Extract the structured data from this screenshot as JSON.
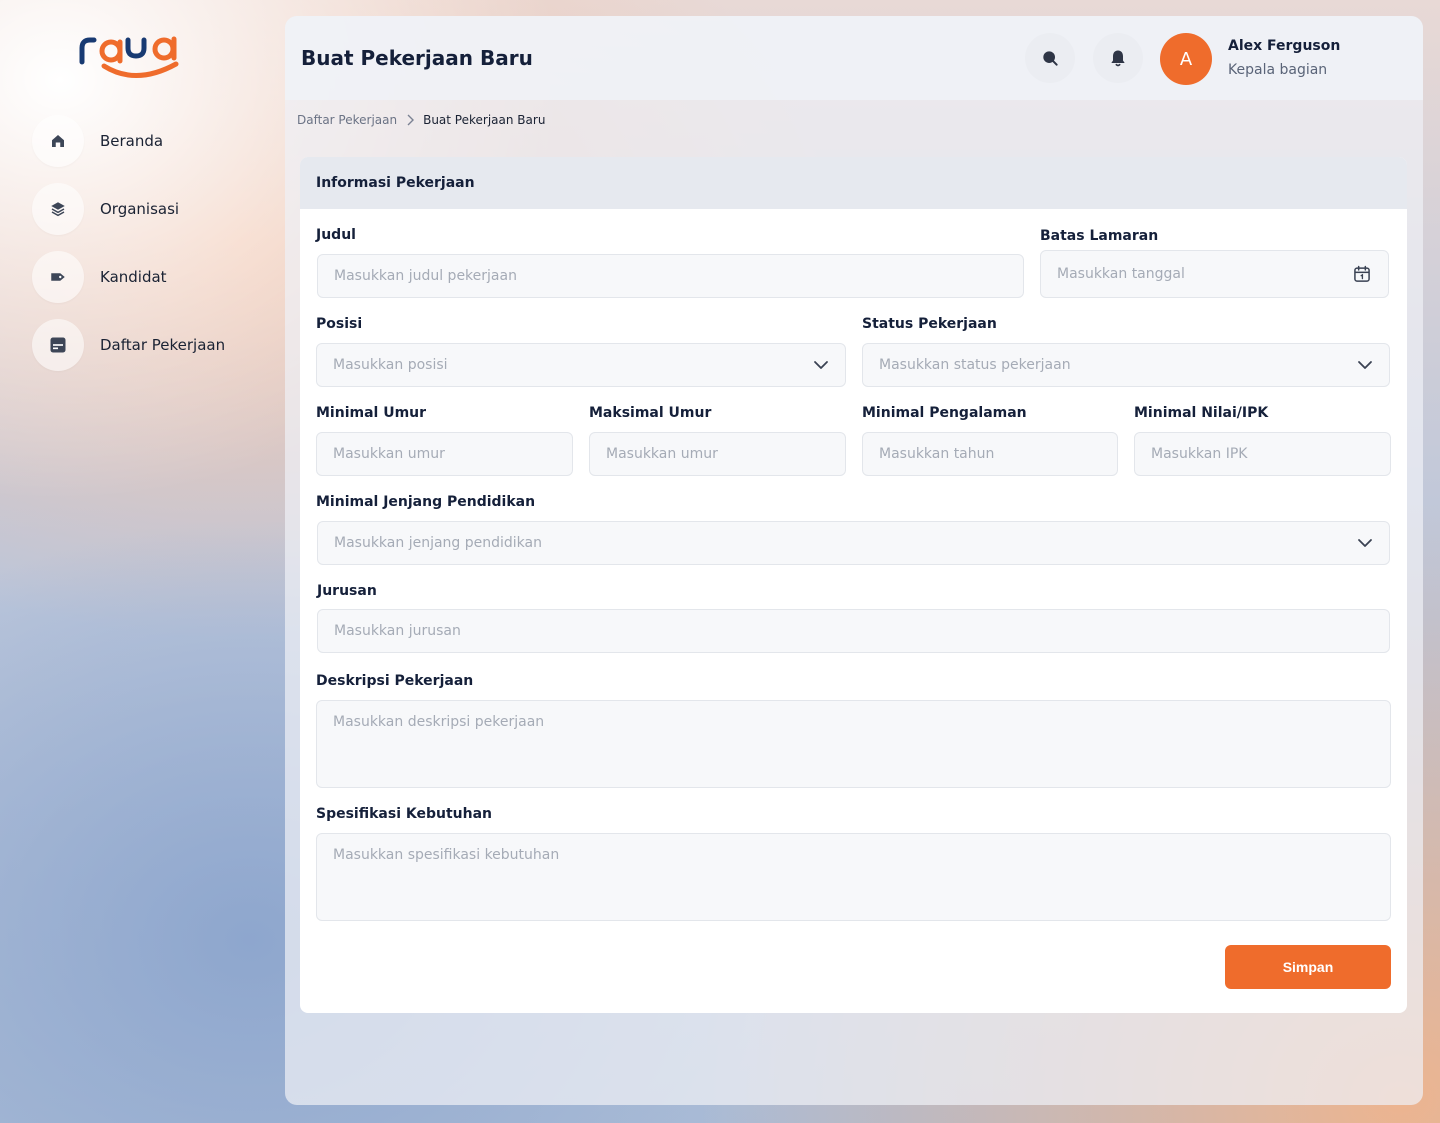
{
  "brand": {
    "logo_text": "raya",
    "accent": "#ef6c2c"
  },
  "sidebar": {
    "items": [
      {
        "label": "Beranda",
        "icon": "home-icon"
      },
      {
        "label": "Organisasi",
        "icon": "layers-icon"
      },
      {
        "label": "Kandidat",
        "icon": "tag-icon"
      },
      {
        "label": "Daftar Pekerjaan",
        "icon": "briefcase-list-icon"
      }
    ]
  },
  "header": {
    "title": "Buat Pekerjaan Baru",
    "search_icon": "search-icon",
    "bell_icon": "bell-icon",
    "user": {
      "initial": "A",
      "name": "Alex Ferguson",
      "role": "Kepala bagian"
    }
  },
  "breadcrumb": {
    "parent": "Daftar Pekerjaan",
    "current": "Buat Pekerjaan Baru"
  },
  "form": {
    "section_title": "Informasi Pekerjaan",
    "judul": {
      "label": "Judul",
      "placeholder": "Masukkan judul pekerjaan"
    },
    "batas_lamaran": {
      "label": "Batas Lamaran",
      "placeholder": "Masukkan tanggal"
    },
    "posisi": {
      "label": "Posisi",
      "placeholder": "Masukkan posisi"
    },
    "status_pekerjaan": {
      "label": "Status Pekerjaan",
      "placeholder": "Masukkan status pekerjaan"
    },
    "minimal_umur": {
      "label": "Minimal Umur",
      "placeholder": "Masukkan umur"
    },
    "maksimal_umur": {
      "label": "Maksimal Umur",
      "placeholder": "Masukkan umur"
    },
    "minimal_pengalaman": {
      "label": "Minimal Pengalaman",
      "placeholder": "Masukkan tahun"
    },
    "minimal_ipk": {
      "label": "Minimal Nilai/IPK",
      "placeholder": "Masukkan IPK"
    },
    "jenjang_pendidikan": {
      "label": "Minimal Jenjang Pendidikan",
      "placeholder": "Masukkan jenjang pendidikan"
    },
    "jurusan": {
      "label": "Jurusan",
      "placeholder": "Masukkan jurusan"
    },
    "deskripsi": {
      "label": "Deskripsi Pekerjaan",
      "placeholder": "Masukkan deskripsi pekerjaan"
    },
    "spesifikasi": {
      "label": "Spesifikasi Kebutuhan",
      "placeholder": "Masukkan spesifikasi kebutuhan"
    },
    "save_label": "Simpan"
  }
}
